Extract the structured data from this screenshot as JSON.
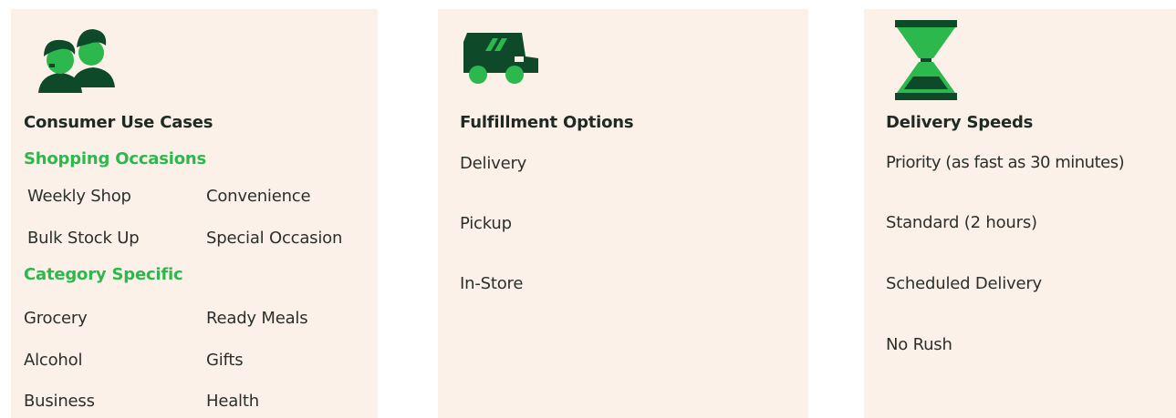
{
  "colors": {
    "panel_bg": "#fbf1e8",
    "dark_green": "#0e4a2a",
    "bright_green": "#2db84e",
    "text_dark": "#1f2a24"
  },
  "consumer": {
    "icon": "people-icon",
    "title": "Consumer Use Cases",
    "shopping_heading": "Shopping Occasions",
    "shopping_items": [
      "Weekly Shop",
      "Convenience",
      "Bulk Stock Up",
      "Special Occasion"
    ],
    "category_heading": "Category Specific",
    "category_items": [
      "Grocery",
      "Ready Meals",
      "Alcohol",
      "Gifts",
      "Business",
      "Health"
    ]
  },
  "fulfillment": {
    "icon": "delivery-truck-icon",
    "title": "Fulfillment Options",
    "items": [
      "Delivery",
      "Pickup",
      "In-Store"
    ]
  },
  "speeds": {
    "icon": "hourglass-icon",
    "title": "Delivery Speeds",
    "items": [
      "Priority (as fast as 30 minutes)",
      "Standard (2 hours)",
      "Scheduled Delivery",
      "No Rush"
    ]
  }
}
